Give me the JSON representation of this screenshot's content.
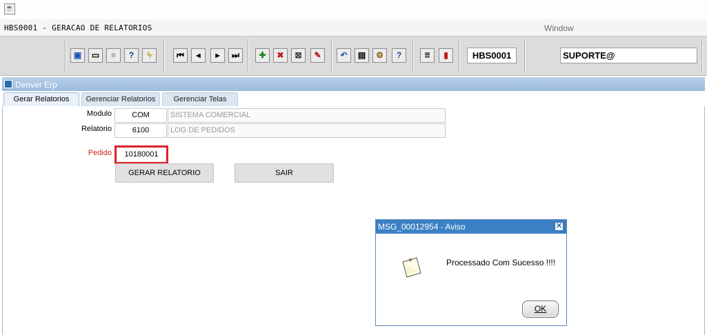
{
  "window": {
    "form_title": "HBS0001 - GERACAO DE RELATORIOS",
    "menu_window": "Window"
  },
  "toolbar": {
    "form_code": "HBS0001",
    "user": "SUPORTE@",
    "icons": [
      "save-icon",
      "print-preview-icon",
      "print-icon",
      "query-help-icon",
      "execute-query-icon",
      "first-record-icon",
      "previous-record-icon",
      "next-record-icon",
      "last-record-icon",
      "insert-record-icon",
      "delete-record-icon",
      "edit-record-icon",
      "clear-field-icon",
      "undo-icon",
      "clipboard-icon",
      "user-keys-icon",
      "help-icon",
      "menu-icon",
      "exit-icon"
    ]
  },
  "inner_window": {
    "title": "Denver Erp"
  },
  "tabs": [
    "Gerar Relatorios",
    "Gerenciar Relatorios",
    "Gerenciar Telas"
  ],
  "form": {
    "modulo_label": "Modulo",
    "modulo_code": "COM",
    "modulo_desc": "SISTEMA COMERCIAL",
    "relatorio_label": "Relatorio",
    "relatorio_code": "6100",
    "relatorio_desc": "LOG DE PEDIDOS",
    "pedido_label": "Pedido",
    "pedido_value": "10180001",
    "generate_label": "GERAR RELATORIO",
    "exit_label": "SAIR"
  },
  "dialog": {
    "title": "MSG_00012954 - Aviso",
    "message": "Processado Com Sucesso !!!!",
    "ok_label": "OK",
    "close_symbol": "✕"
  },
  "colors": {
    "highlight_border": "#e0232a",
    "dialog_title": "#3b80c4",
    "inner_title": "#9cbcdc",
    "pedido_label": "#d42020"
  }
}
